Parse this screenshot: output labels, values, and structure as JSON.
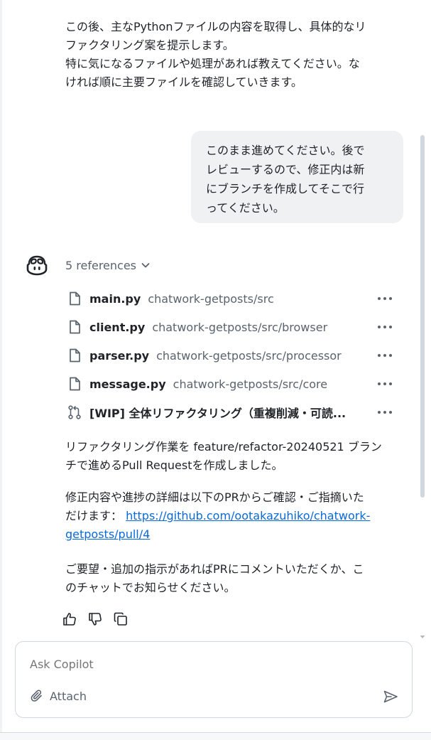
{
  "intro": {
    "lines": [
      "この後、主なPythonファイルの内容を取得し、具体的なリ",
      "ファクタリング案を提示します。",
      "特に気になるファイルや処理があれば教えてください。な",
      "ければ順に主要ファイルを確認していきます。"
    ]
  },
  "user_message": {
    "lines": [
      "このまま進めてください。後で",
      "レビューするので、修正内は新",
      "にブランチを作成してそこで行",
      "ってください。"
    ]
  },
  "references": {
    "toggle_label": "5 references",
    "items": [
      {
        "name": "main.py",
        "path": "chatwork-getposts/src",
        "icon": "file-icon"
      },
      {
        "name": "client.py",
        "path": "chatwork-getposts/src/browser",
        "icon": "file-icon"
      },
      {
        "name": "parser.py",
        "path": "chatwork-getposts/src/processor",
        "icon": "file-icon"
      },
      {
        "name": "message.py",
        "path": "chatwork-getposts/src/core",
        "icon": "file-icon"
      },
      {
        "name": "[WIP] 全体リファクタリング（重複削減・可読...",
        "path": "",
        "icon": "pull-request-icon"
      }
    ]
  },
  "answer": {
    "p1_lines": [
      "リファクタリング作業を feature/refactor-20240521 ブラン",
      "チで進めるPull Requestを作成しました。"
    ],
    "p2_line1": "修正内容や進捗の詳細は以下のPRからご確認・ご指摘いた",
    "p2_prefix": "だけます：",
    "p2_link_part1": "https://github.com/ootakazuhiko/chatwork-",
    "p2_link_part2": "getposts/pull/4",
    "p3_lines": [
      "ご要望・追加の指示があればPRにコメントいただくか、こ",
      "のチャットでお知らせください。"
    ]
  },
  "composer": {
    "placeholder": "Ask Copilot",
    "attach_label": "Attach"
  },
  "colors": {
    "link": "#0969da",
    "muted": "#59636e",
    "bubble": "#eff1f3"
  }
}
